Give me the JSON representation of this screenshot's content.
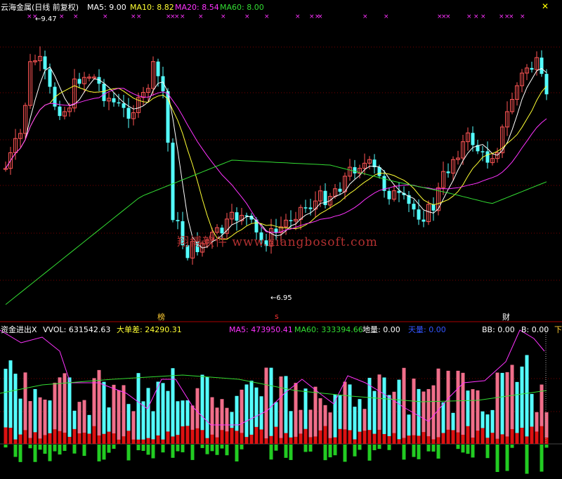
{
  "colors": {
    "up": "#ff5555",
    "upBar": "#f06e8a",
    "down": "#54ffff",
    "ma5": "#ffffff",
    "ma10": "#ffff33",
    "ma20": "#ff33ff",
    "ma60": "#33dd33",
    "grid": "#7a0000",
    "axis": "#aa0000",
    "yellow": "#ffff00",
    "blue": "#3355ff"
  },
  "header": {
    "title": "云海金属(日线 前复权)",
    "ma5": "MA5: 9.00",
    "ma10": "MA10: 8.82",
    "ma20": "MA20: 8.54",
    "ma60": "MA60: 8.00"
  },
  "watermark": "翔博软件 www.xiangbosoft.com",
  "price_annotations": {
    "high": "9.47",
    "low": "6.95"
  },
  "event_marks": {
    "bang": "榜",
    "s": "s",
    "cai": "财"
  },
  "lower": {
    "title": "资金进出X",
    "vvol": "VVOL: 631542.63",
    "dadancha": "大单差: 24290.31",
    "ma5": "MA5: 473950.41",
    "ma60": "MA60: 333394.66",
    "diliang": "地量: 0.00",
    "tianliang": "天量: 0.00",
    "bb": "BB: 0.00",
    "b": "B: 0.00",
    "xia": "下"
  },
  "chart_data": [
    {
      "type": "candlestick",
      "title": "云海金属(日线 前复权)",
      "price_range": [
        6.95,
        9.47
      ],
      "series": [
        {
          "name": "MA5",
          "value": 9.0
        },
        {
          "name": "MA10",
          "value": 8.82
        },
        {
          "name": "MA20",
          "value": 8.54
        },
        {
          "name": "MA60",
          "value": 8.0
        }
      ],
      "annotations": [
        {
          "label": "9.47",
          "kind": "high"
        },
        {
          "label": "6.95",
          "kind": "low"
        }
      ]
    },
    {
      "type": "bar",
      "title": "资金进出X",
      "series": [
        {
          "name": "VVOL",
          "value": 631542.63
        },
        {
          "name": "大单差",
          "value": 24290.31
        },
        {
          "name": "MA5",
          "value": 473950.41
        },
        {
          "name": "MA60",
          "value": 333394.66
        },
        {
          "name": "地量",
          "value": 0.0
        },
        {
          "name": "天量",
          "value": 0.0
        },
        {
          "name": "BB",
          "value": 0.0
        },
        {
          "name": "B",
          "value": 0.0
        }
      ]
    }
  ]
}
